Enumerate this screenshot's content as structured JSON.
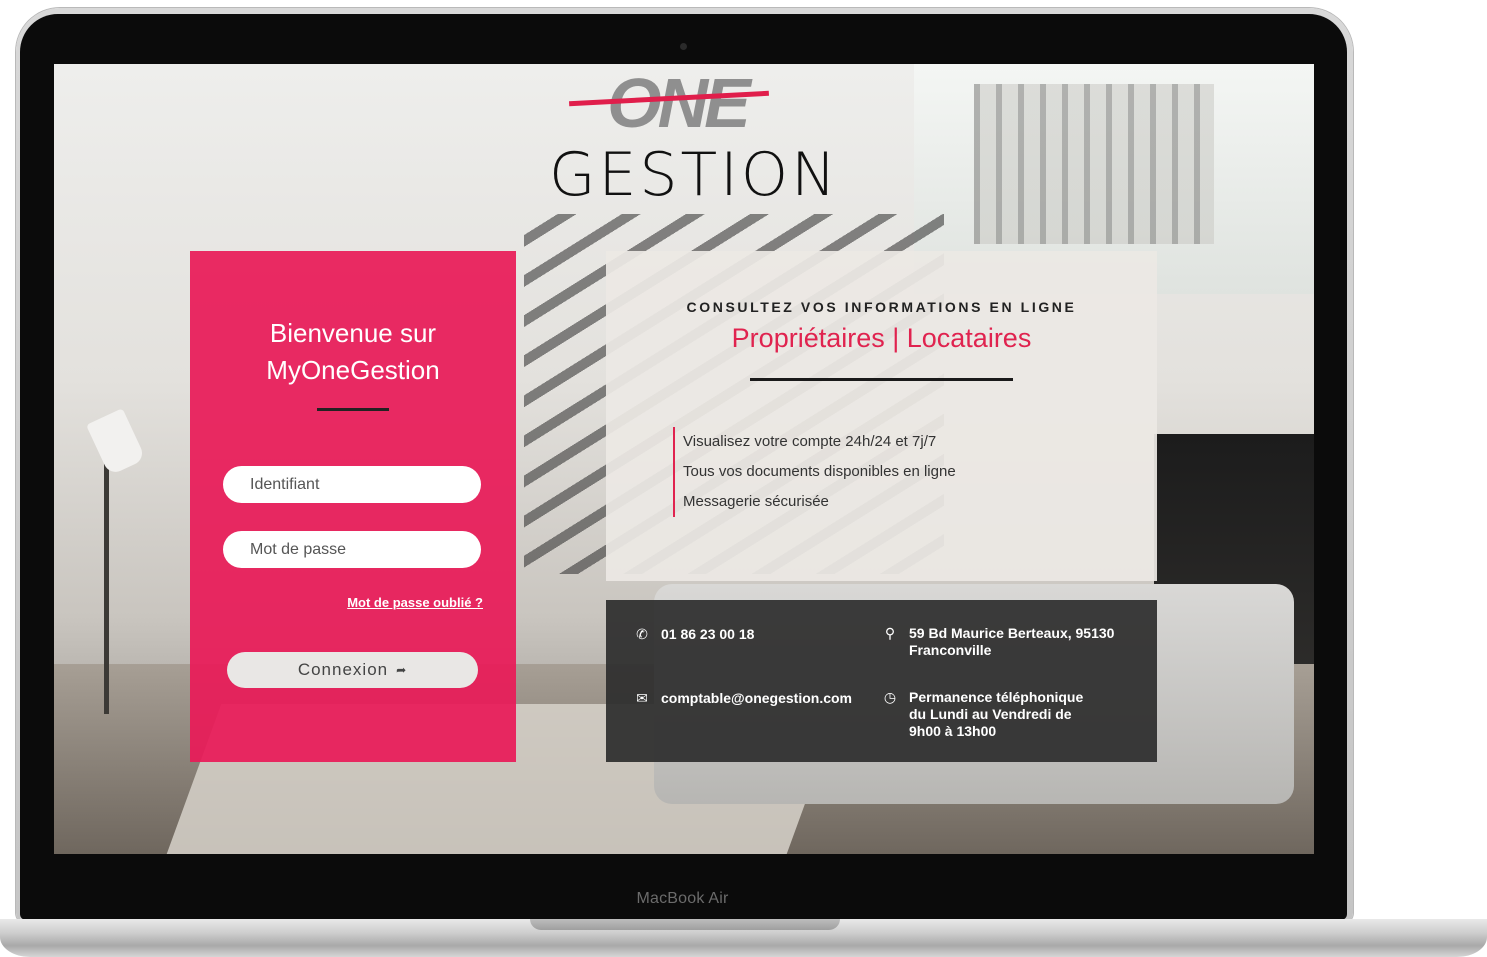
{
  "device": {
    "label": "MacBook Air"
  },
  "logo": {
    "top": "ONE",
    "bottom": "GESTION"
  },
  "login": {
    "title_line1": "Bienvenue sur",
    "title_line2": "MyOneGestion",
    "username_placeholder": "Identifiant",
    "password_placeholder": "Mot de passe",
    "forgot_label": "Mot de passe oublié ?",
    "connect_label": "Connexion"
  },
  "info": {
    "kicker": "CONSULTEZ VOS INFORMATIONS EN LIGNE",
    "headline": "Propriétaires | Locataires",
    "features": [
      "Visualisez votre compte 24h/24 et 7j/7",
      "Tous vos documents disponibles en ligne",
      "Messagerie sécurisée"
    ]
  },
  "contact": {
    "phone": "01 86 23 00 18",
    "email": "comptable@onegestion.com",
    "address": "59 Bd Maurice Berteaux, 95130 Franconville",
    "hours": "Permanence téléphonique du Lundi au Vendredi de 9h00 à 13h00"
  },
  "icons": {
    "phone": "phone-icon",
    "email": "envelope-icon",
    "address": "location-pin-icon",
    "hours": "clock-icon",
    "connect": "circle-arrow-icon"
  },
  "colors": {
    "accent": "#e81b58",
    "contact_bg": "#2d2d2d",
    "info_bg": "#ece8e4"
  }
}
